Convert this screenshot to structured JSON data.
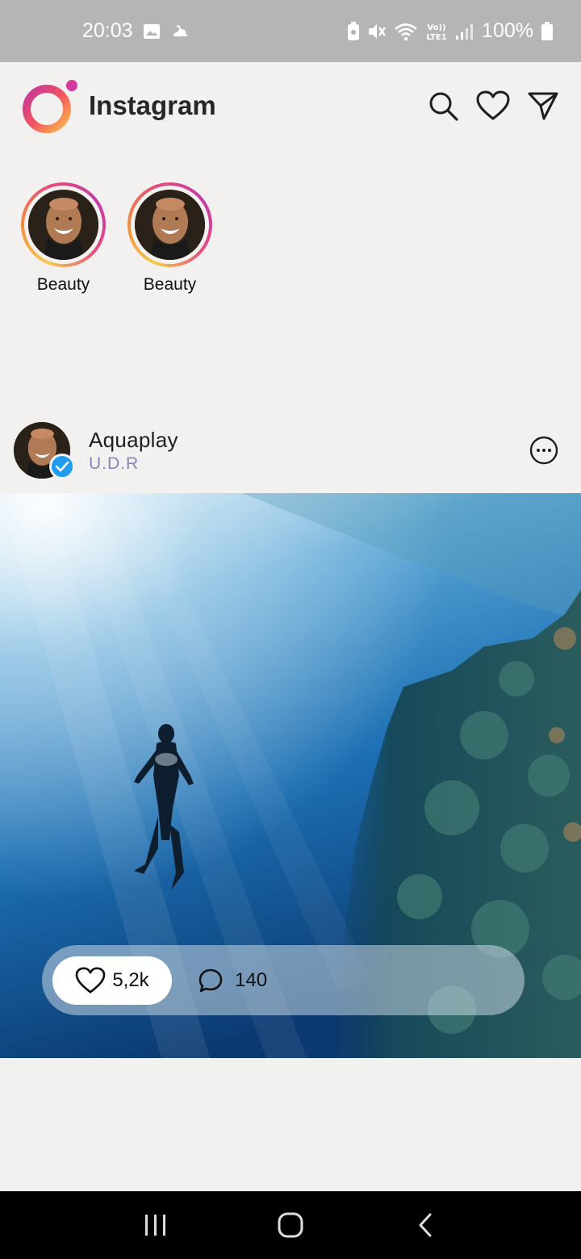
{
  "status_bar": {
    "time": "20:03",
    "battery": "100%",
    "icons": [
      "image-icon",
      "weather-icon",
      "battery-saver-icon",
      "mute-icon",
      "wifi-icon",
      "volte-icon",
      "signal-icon",
      "battery-icon"
    ]
  },
  "header": {
    "app_name": "Instagram",
    "actions": [
      "search-icon",
      "heart-icon",
      "send-icon"
    ]
  },
  "stories": [
    {
      "label": "Beauty"
    },
    {
      "label": "Beauty"
    }
  ],
  "post": {
    "username": "Aquaplay",
    "subtitle": "U.D.R",
    "verified": true,
    "likes": "5,2k",
    "comments": "140"
  },
  "colors": {
    "background": "#f2f1f0",
    "verified": "#1f9cf0",
    "subtitle": "#8a86b4",
    "status_bar": "#b6b5b5"
  },
  "nav_bar": [
    "recent-apps-icon",
    "home-icon",
    "back-icon"
  ]
}
